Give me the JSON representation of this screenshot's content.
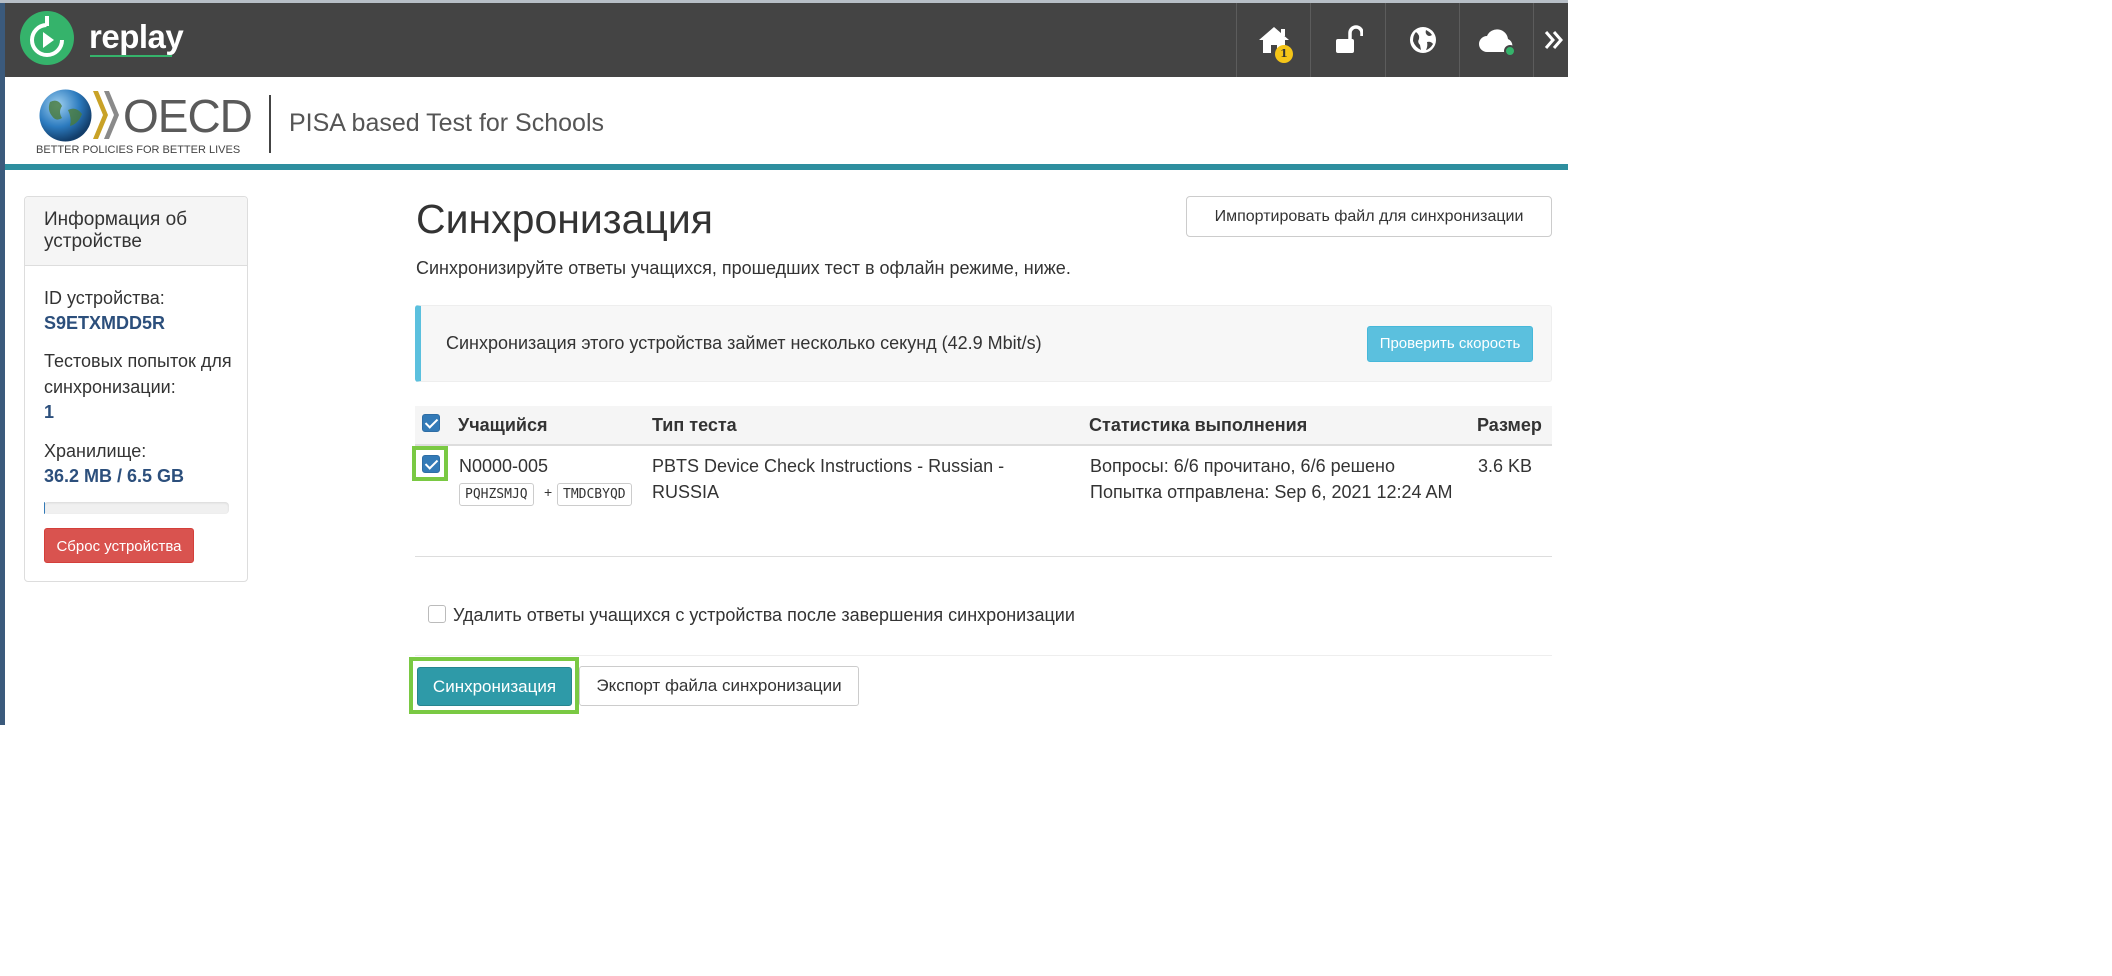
{
  "app": {
    "name": "replay",
    "home_badge": "1",
    "colors": {
      "topbar": "#444444",
      "brand_green": "#35b36b",
      "accent_teal": "#2e8f9f",
      "info": "#5bc0de",
      "danger": "#d9534f",
      "highlight": "#7ac943",
      "link_blue": "#2c4f7c"
    },
    "toolbar_icons": [
      "home-icon",
      "unlock-icon",
      "globe-icon",
      "cloud-icon",
      "double-chevron-right-icon"
    ]
  },
  "header": {
    "org_word": "OECD",
    "org_tagline": "BETTER POLICIES FOR BETTER LIVES",
    "product_title": "PISA based Test for Schools"
  },
  "sidebar": {
    "title": "Информация об устройстве",
    "device_id_label": "ID устройства:",
    "device_id": "S9ETXMDD5R",
    "attempts_label": "Тестовых попыток для синхронизации:",
    "attempts": "1",
    "storage_label": "Хранилище:",
    "storage": "36.2 MB / 6.5 GB",
    "storage_fraction": 0.0056,
    "reset_button": "Сброс устройства"
  },
  "main": {
    "title": "Синхронизация",
    "import_button": "Импортировать файл для синхронизации",
    "lead": "Синхронизируйте ответы учащихся, прошедших тест в офлайн режиме, ниже.",
    "speed_notice": "Синхронизация этого устройства займет несколько секунд (42.9 Mbit/s)",
    "speed_button": "Проверить скорость",
    "table": {
      "headers": {
        "student": "Учащийся",
        "test_type": "Тип теста",
        "stats": "Статистика выполнения",
        "size": "Размер"
      },
      "rows": [
        {
          "checked": true,
          "student_id": "N0000-005",
          "code1": "PQHZSMJQ",
          "code2": "TMDCBYQD",
          "test_type_line1": "PBTS Device Check Instructions - Russian -",
          "test_type_line2": "RUSSIA",
          "stats_line1": "Вопросы: 6/6 прочитано, 6/6 решено",
          "stats_line2": "Попытка отправлена: Sep 6, 2021 12:24 AM",
          "size": "3.6 KB"
        }
      ]
    },
    "delete_option": "Удалить ответы учащихся с устройства после завершения синхронизации",
    "sync_button": "Синхронизация",
    "export_button": "Экспорт файла синхронизации"
  }
}
